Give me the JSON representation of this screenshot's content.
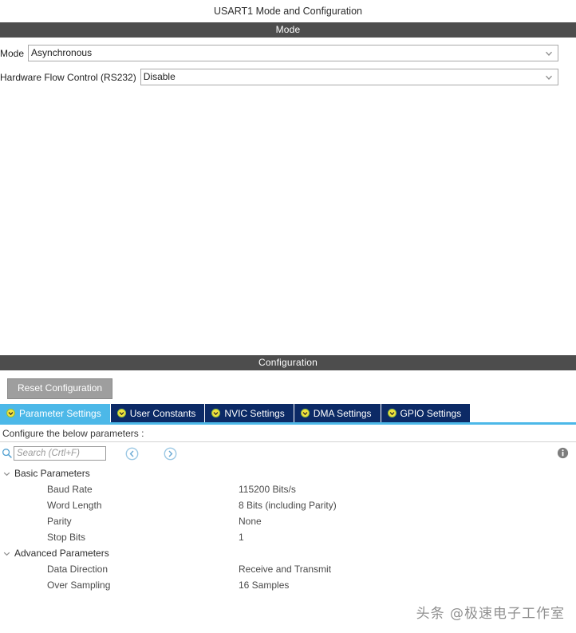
{
  "panel": {
    "title": "USART1 Mode and Configuration"
  },
  "mode_section": {
    "header": "Mode",
    "fields": [
      {
        "label": "Mode",
        "value": "Asynchronous",
        "icon": "chevron-down-icon"
      },
      {
        "label": "Hardware Flow Control (RS232)",
        "value": "Disable",
        "icon": "chevron-down-icon"
      }
    ]
  },
  "configuration_section": {
    "header": "Configuration",
    "reset_button": "Reset Configuration",
    "tabs": [
      {
        "label": "Parameter Settings",
        "icon": "status-ok-icon",
        "active": true
      },
      {
        "label": "User Constants",
        "icon": "status-ok-icon",
        "active": false
      },
      {
        "label": "NVIC Settings",
        "icon": "status-ok-icon",
        "active": false
      },
      {
        "label": "DMA Settings",
        "icon": "status-ok-icon",
        "active": false
      },
      {
        "label": "GPIO Settings",
        "icon": "status-ok-icon",
        "active": false
      }
    ],
    "configure_label": "Configure the below parameters :",
    "search": {
      "placeholder": "Search (Crtl+F)",
      "value": "",
      "icon": "search-icon",
      "prev_icon": "nav-back-icon",
      "next_icon": "nav-forward-icon"
    },
    "info_icon": "info-icon",
    "parameter_tree": [
      {
        "group": "Basic Parameters",
        "expanded": true,
        "rows": [
          {
            "name": "Baud Rate",
            "value": "115200 Bits/s"
          },
          {
            "name": "Word Length",
            "value": "8 Bits (including Parity)"
          },
          {
            "name": "Parity",
            "value": "None"
          },
          {
            "name": "Stop Bits",
            "value": "1"
          }
        ]
      },
      {
        "group": "Advanced Parameters",
        "expanded": true,
        "rows": [
          {
            "name": "Data Direction",
            "value": "Receive and Transmit"
          },
          {
            "name": "Over Sampling",
            "value": "16 Samples"
          }
        ]
      }
    ]
  },
  "watermark": {
    "text": "头条 @极速电子工作室"
  },
  "colors": {
    "section_bar": "#4d4d4d",
    "tab_active": "#4cb8e8",
    "tab_inactive": "#0c2a66",
    "reset_button": "#9e9e9e",
    "tab_dot": "#f2e23c",
    "nav_button": "#5aa9d6"
  }
}
